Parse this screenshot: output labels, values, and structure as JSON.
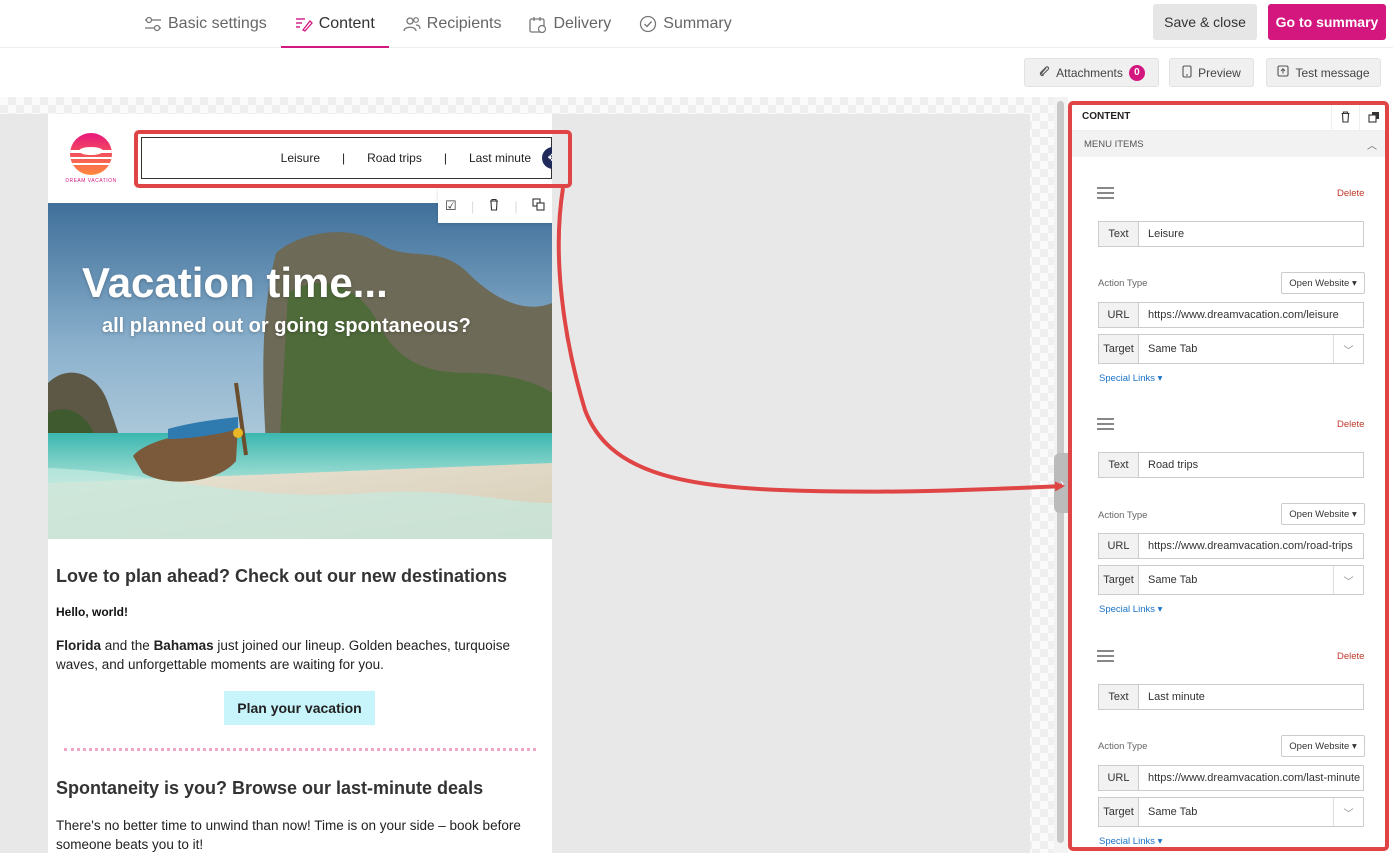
{
  "header": {
    "tabs": [
      {
        "label": "Basic settings",
        "icon": "sliders-icon"
      },
      {
        "label": "Content",
        "icon": "edit-icon"
      },
      {
        "label": "Recipients",
        "icon": "users-icon"
      },
      {
        "label": "Delivery",
        "icon": "calendar-icon"
      },
      {
        "label": "Summary",
        "icon": "check-circle-icon"
      }
    ],
    "active_tab": "Content",
    "save_close": "Save & close",
    "go_summary": "Go to summary"
  },
  "toolbar": {
    "attachments": "Attachments",
    "attachments_count": "0",
    "preview": "Preview",
    "test_message": "Test message"
  },
  "email": {
    "logo_text": "DREAM VACATION",
    "menu": [
      "Leisure",
      "Road trips",
      "Last minute"
    ],
    "menu_separator": "|",
    "hero_title": "Vacation time...",
    "hero_subtitle": "all planned out or going spontaneous?",
    "section1_title": "Love to plan ahead? Check out our new destinations",
    "greeting": "Hello, world!",
    "para1": {
      "b1": "Florida",
      "t1": " and the ",
      "b2": "Bahamas",
      "t2": " just joined our lineup. Golden beaches, turquoise waves, and unforgettable moments are waiting for you."
    },
    "cta": "Plan your vacation",
    "section2_title": "Spontaneity is you? Browse our last-minute deals",
    "para2": "There's no better time to unwind than now! Time is on your side – book before someone beats you to it!"
  },
  "panel": {
    "title": "CONTENT",
    "section": "MENU ITEMS",
    "delete_label": "Delete",
    "text_label": "Text",
    "action_type_label": "Action Type",
    "url_label": "URL",
    "target_label": "Target",
    "special_links": "Special Links ▾",
    "items": [
      {
        "text": "Leisure",
        "action_type": "Open Website ▾",
        "url": "https://www.dreamvacation.com/leisure",
        "target": "Same Tab"
      },
      {
        "text": "Road trips",
        "action_type": "Open Website ▾",
        "url": "https://www.dreamvacation.com/road-trips",
        "target": "Same Tab"
      },
      {
        "text": "Last minute",
        "action_type": "Open Website ▾",
        "url": "https://www.dreamvacation.com/last-minute",
        "target": "Same Tab"
      }
    ]
  },
  "colors": {
    "accent": "#d4177f",
    "highlight": "#e04545",
    "cta_bg": "#c8f4fb",
    "move_handle": "#1f2a5a"
  }
}
